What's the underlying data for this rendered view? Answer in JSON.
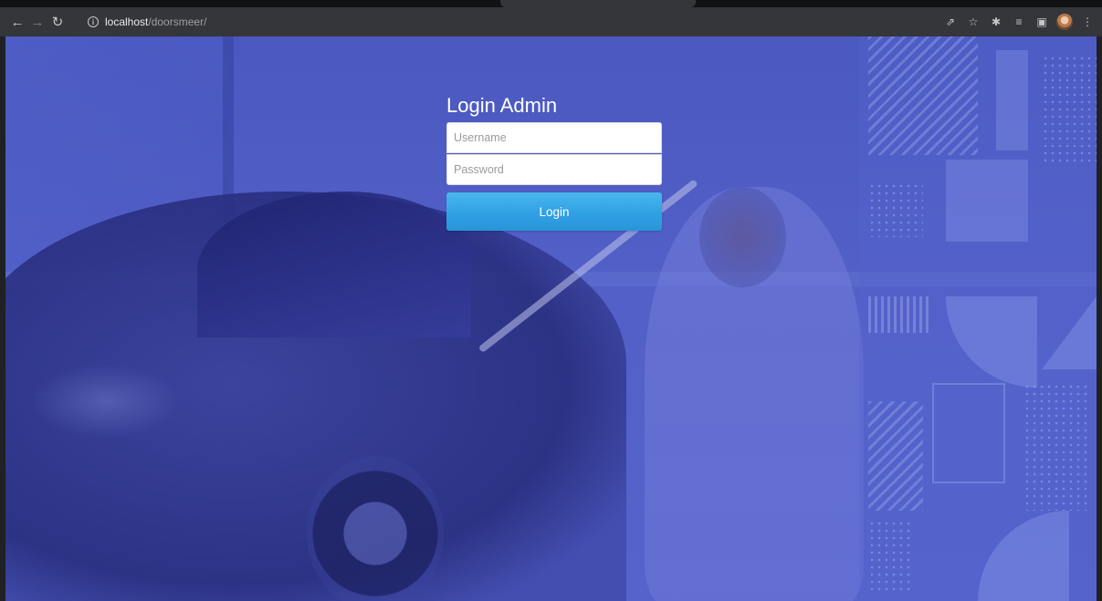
{
  "browser": {
    "url_host": "localhost",
    "url_path": "/doorsmeer/",
    "nav": {
      "back_icon": "arrow-left-icon",
      "forward_icon": "arrow-right-icon",
      "reload_icon": "reload-icon"
    },
    "toolbar_icons": [
      "share-icon",
      "star-icon",
      "extensions-icon",
      "reading-list-icon",
      "side-panel-icon",
      "profile-avatar",
      "menu-icon"
    ]
  },
  "login": {
    "title": "Login Admin",
    "username_placeholder": "Username",
    "password_placeholder": "Password",
    "submit_label": "Login"
  },
  "colors": {
    "background_accent": "#5260c6",
    "button_top": "#4ab6ee",
    "button_bottom": "#2a95d8"
  }
}
